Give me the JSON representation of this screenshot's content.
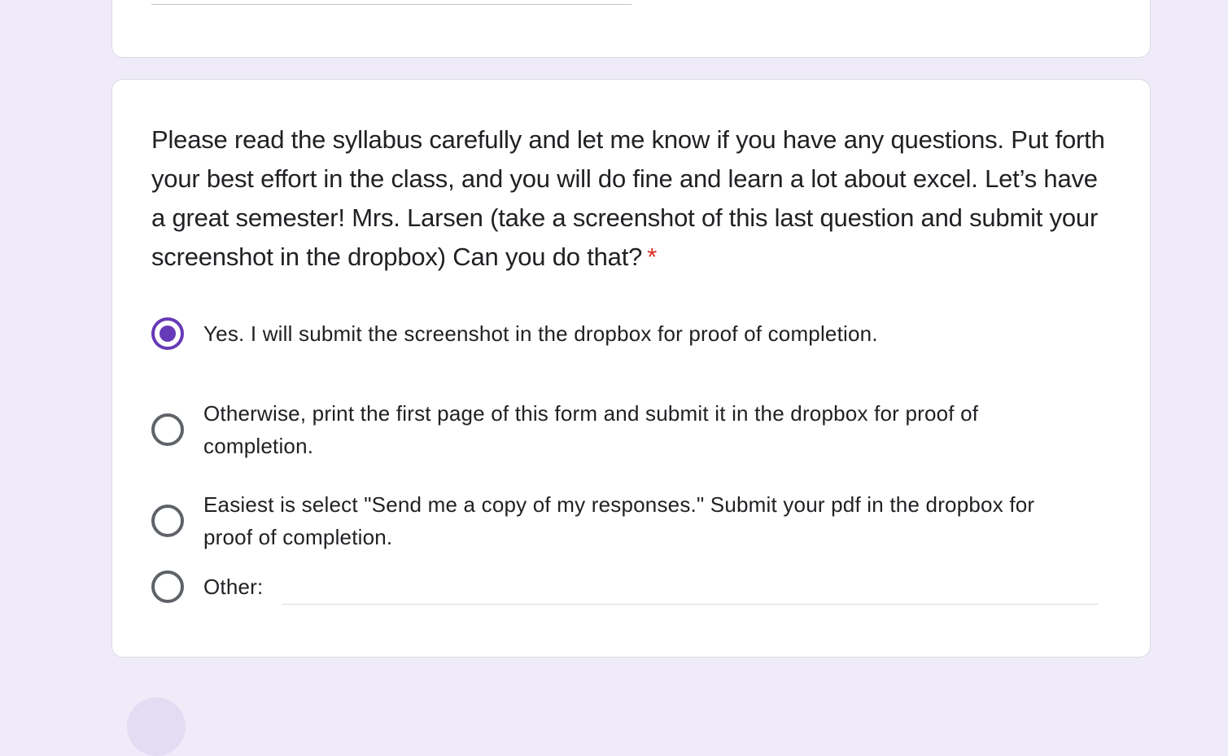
{
  "question": {
    "title": "Please read the syllabus carefully and let me know if you have any questions. Put forth your best effort in the class, and you will do fine and learn a lot about excel. Let’s have a great semester! Mrs. Larsen (take a screenshot of this last question and submit your screenshot in the dropbox) Can you do that?",
    "required_marker": "*",
    "options": [
      {
        "label": "Yes. I will submit the screenshot in the dropbox for proof of completion.",
        "selected": true
      },
      {
        "label": "Otherwise, print the first page of this form and submit it in the dropbox for proof of completion.",
        "selected": false
      },
      {
        "label": "Easiest is select \"Send me a copy of my responses.\" Submit your pdf in the dropbox for proof of completion.",
        "selected": false
      }
    ],
    "other": {
      "label": "Other:",
      "value": "",
      "selected": false
    }
  },
  "colors": {
    "accent": "#673ab7",
    "page_background": "#f0ebf8",
    "required": "#d93025"
  }
}
